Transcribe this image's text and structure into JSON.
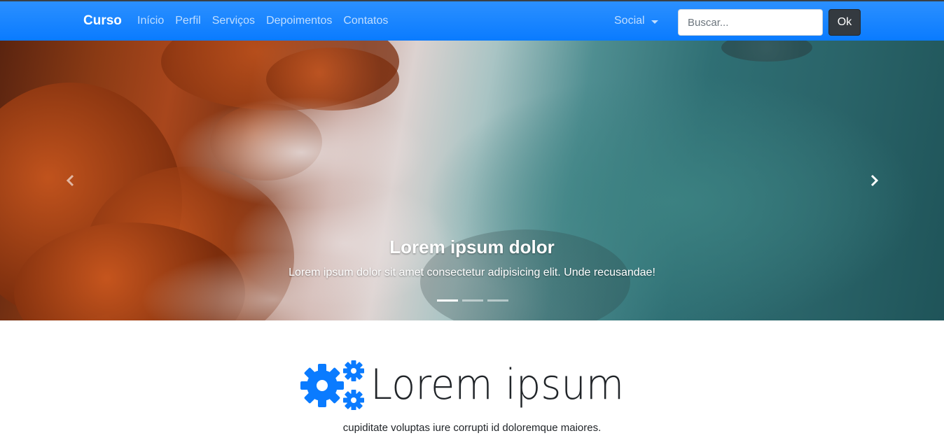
{
  "navbar": {
    "brand": "Curso",
    "links": [
      "Início",
      "Perfil",
      "Serviços",
      "Depoimentos",
      "Contatos"
    ],
    "social_label": "Social",
    "search": {
      "placeholder": "Buscar...",
      "value": ""
    },
    "submit_label": "Ok",
    "accent_color": "#0a7bff"
  },
  "carousel": {
    "caption_title": "Lorem ipsum dolor",
    "caption_text": "Lorem ipsum dolor sit amet consectetur adipisicing elit. Unde recusandae!",
    "slide_count": 3,
    "active_slide": 1,
    "prev_icon": "chevron-left-icon",
    "next_icon": "chevron-right-icon"
  },
  "hero": {
    "icon": "gears-icon",
    "title": "Lorem ipsum",
    "subtitle": "cupiditate voluptas iure corrupti id doloremque maiores."
  }
}
